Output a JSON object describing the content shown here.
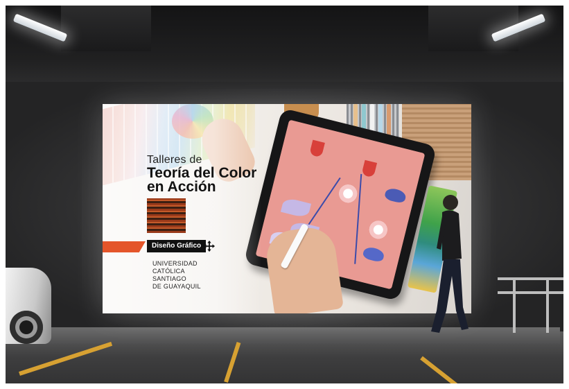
{
  "billboard": {
    "title_line1": "Talleres de",
    "title_line2": "Teoría del Color",
    "title_line3": "en Acción",
    "department_label": "Diseño Gráfico",
    "university_lines": [
      "UNIVERSIDAD",
      "CATÓLICA",
      "SANTIAGO",
      "DE GUAYAQUIL"
    ]
  },
  "colors": {
    "accent_orange": "#e4552a",
    "label_bg": "#111111",
    "parking_stripe": "#d7a132"
  },
  "icons": {
    "move": "move-arrows-icon"
  }
}
